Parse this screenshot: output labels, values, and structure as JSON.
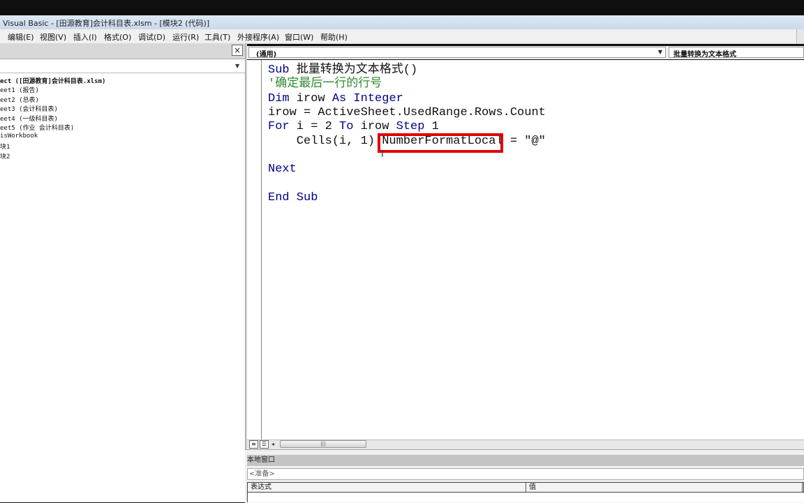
{
  "window": {
    "title": "Visual Basic - [田源教育]会计科目表.xlsm - [模块2 (代码)]"
  },
  "menu": [
    "编辑(E)",
    "视图(V)",
    "插入(I)",
    "格式(O)",
    "调试(D)",
    "运行(R)",
    "工具(T)",
    "外接程序(A)",
    "窗口(W)",
    "帮助(H)"
  ],
  "project_explorer": {
    "close_glyph": "×",
    "items": [
      "ect ([田源教育]会计科目表.xlsm)",
      "eet1 (报告)",
      "eet2 (总表)",
      "eet3 (会计科目表)",
      "eet4 (一级科目表)",
      "eet5 (作业 会计科目表)",
      "isWorkbook",
      "块1",
      "块2"
    ]
  },
  "code_window": {
    "object_combo": "(通用)",
    "procedure_combo": "批量转换为文本格式",
    "lines": {
      "l1_kw": "Sub",
      "l1_rest": " 批量转换为文本格式()",
      "l2_comment": "'确定最后一行的行号",
      "l3_kw1": "Dim",
      "l3_mid": " irow ",
      "l3_kw2": "As Integer",
      "l4": "irow = ActiveSheet.UsedRange.Rows.Count",
      "l5_kw1": "For",
      "l5_a": " i = 2 ",
      "l5_kw2": "To",
      "l5_b": " irow ",
      "l5_kw3": "Step",
      "l5_c": " 1",
      "l6": "    Cells(i, 1).NumberFormatLocal = \"@\"",
      "l7_kw": "Next",
      "l8_kw": "End Sub"
    },
    "highlight_target": "NumberFormatLocal"
  },
  "locals_window": {
    "title": "本地窗口",
    "context": "<准备>",
    "col_expression": "表达式",
    "col_value": "值"
  },
  "colors": {
    "keyword": "#00008b",
    "comment": "#2e8b2e",
    "highlight": "#e00000"
  }
}
